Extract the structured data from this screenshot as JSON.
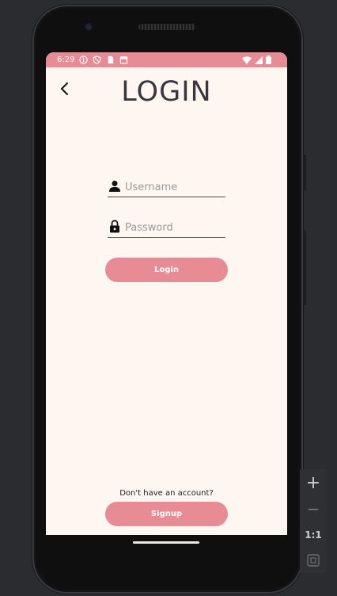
{
  "status_bar": {
    "time": "6:29",
    "left_icons": [
      "info-icon",
      "shield-icon",
      "sim-card-icon",
      "calendar-icon"
    ],
    "right_icons": [
      "wifi-icon",
      "signal-icon",
      "battery-icon"
    ]
  },
  "header": {
    "title": "LOGIN",
    "back_icon": "arrow-left-icon"
  },
  "form": {
    "username": {
      "placeholder": "Username",
      "value": "",
      "icon": "person-icon"
    },
    "password": {
      "placeholder": "Password",
      "value": "",
      "icon": "lock-icon"
    },
    "login_label": "Login"
  },
  "footer": {
    "prompt": "Don't have an account?",
    "signup_label": "Signup"
  },
  "emulator_toolbar": {
    "zoom_in": "+",
    "zoom_out": "−",
    "actual_size": "1:1"
  },
  "colors": {
    "accent": "#e78b95",
    "background": "#fdf6f1",
    "title": "#3a3640"
  }
}
